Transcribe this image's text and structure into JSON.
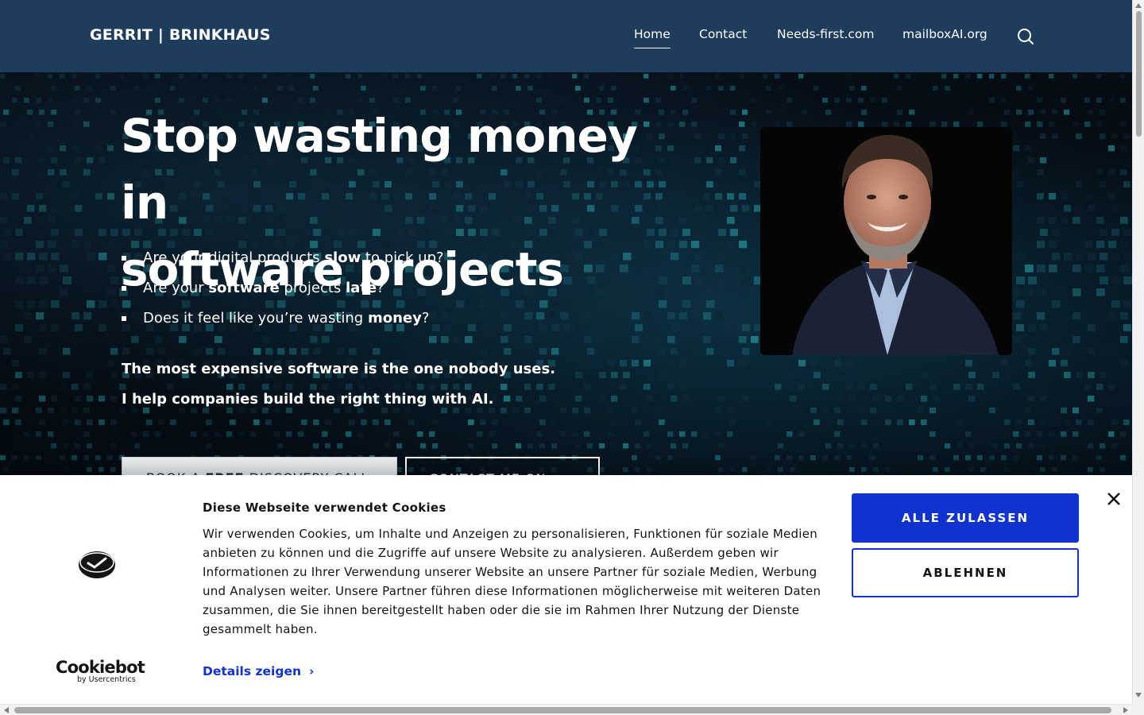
{
  "header": {
    "brand": "GERRIT | BRINKHAUS",
    "nav": [
      {
        "label": "Home",
        "active": true
      },
      {
        "label": "Contact",
        "active": false
      },
      {
        "label": "Needs-first.com",
        "active": false
      },
      {
        "label": "mailboxAI.org",
        "active": false
      }
    ],
    "search_icon": "search-icon"
  },
  "hero": {
    "title_line1": "Stop wasting money in",
    "title_line2": "software projects",
    "bullets": [
      {
        "pre": "Are your digital products ",
        "bold1": "slow",
        "mid": " to pick up?",
        "bold2": "",
        "post": ""
      },
      {
        "pre": "Are your ",
        "bold1": "software",
        "mid": " projects ",
        "bold2": "late",
        "post": "?"
      },
      {
        "pre": "Does it feel like you’re wasting ",
        "bold1": "money",
        "mid": "?",
        "bold2": "",
        "post": ""
      }
    ],
    "tagline1": "The most expensive software is the one nobody uses.",
    "tagline2": "I help companies build the right thing with AI.",
    "book_button": {
      "pre": "BOOK A ",
      "bold": "FREE",
      "post": " DISCOVERY CALL"
    },
    "contact_button": {
      "label": "CONTACT ME ON",
      "icon": "linkedin-icon"
    }
  },
  "cookie_banner": {
    "title": "Diese Webseite verwendet Cookies",
    "text": "Wir verwenden Cookies, um Inhalte und Anzeigen zu personalisieren, Funktionen für soziale Medien anbieten zu können und die Zugriffe auf unsere Website zu analysieren. Außerdem geben wir Informationen zu Ihrer Verwendung unserer Website an unsere Partner für soziale Medien, Werbung und Analysen weiter. Unsere Partner führen diese Informationen möglicherweise mit weiteren Daten zusammen, die Sie ihnen bereitgestellt haben oder die sie im Rahmen Ihrer Nutzung der Dienste gesammelt haben.",
    "details_link": "Details zeigen",
    "allow_all": "ALLE ZULASSEN",
    "deny": "ABLEHNEN",
    "brand_name": "Cookiebot",
    "brand_sub": "by Usercentrics",
    "accent_color": "#1032cf"
  },
  "colors": {
    "header_bg": "#1e3d5c",
    "hero_bg": "#06101a",
    "banner_bg": "#ffffff"
  }
}
